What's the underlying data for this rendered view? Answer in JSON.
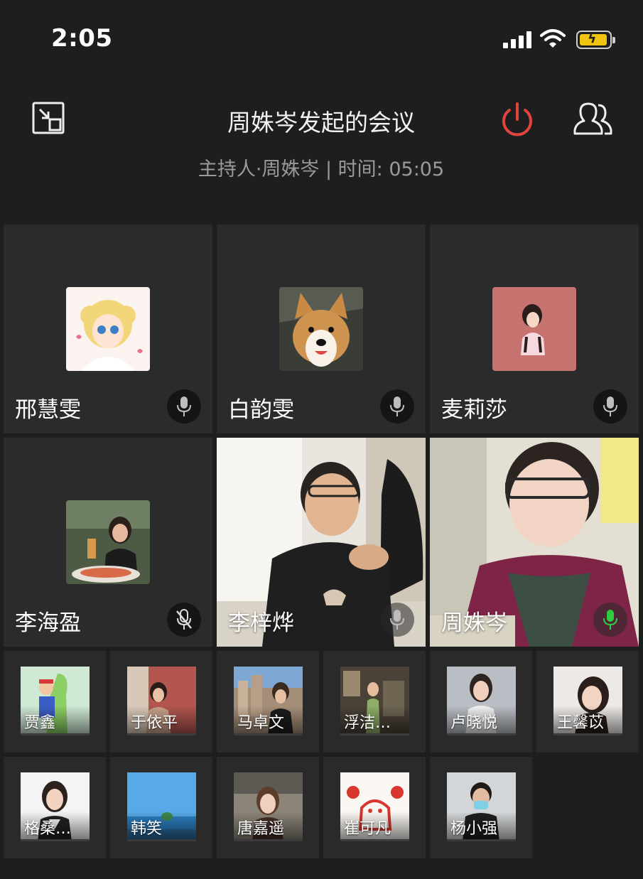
{
  "status_bar": {
    "time": "2:05"
  },
  "header": {
    "title": "周姝岑发起的会议",
    "subtitle": "主持人·周姝岑 | 时间: 05:05",
    "power_color": "#e0443e"
  },
  "participants_large": [
    {
      "name": "邢慧雯",
      "mic": "on",
      "mode": "avatar"
    },
    {
      "name": "白韵雯",
      "mic": "on",
      "mode": "avatar"
    },
    {
      "name": "麦莉莎",
      "mic": "on",
      "mode": "avatar"
    },
    {
      "name": "李海盈",
      "mic": "muted",
      "mode": "avatar"
    },
    {
      "name": "李梓烨",
      "mic": "on",
      "mode": "video"
    },
    {
      "name": "周姝岑",
      "mic": "speaking",
      "mode": "video"
    }
  ],
  "participants_small": [
    {
      "name": "贾鑫"
    },
    {
      "name": "于依平"
    },
    {
      "name": "马卓文"
    },
    {
      "name": "浮洁…"
    },
    {
      "name": "卢晓悦"
    },
    {
      "name": "王馨苡"
    },
    {
      "name": "格桑…"
    },
    {
      "name": "韩笑"
    },
    {
      "name": "唐嘉遥"
    },
    {
      "name": "崔可凡"
    },
    {
      "name": "杨小强"
    }
  ],
  "colors": {
    "speaking_mic": "#2ecc40",
    "background": "#1e1e1e",
    "tile": "#2b2b2b"
  }
}
